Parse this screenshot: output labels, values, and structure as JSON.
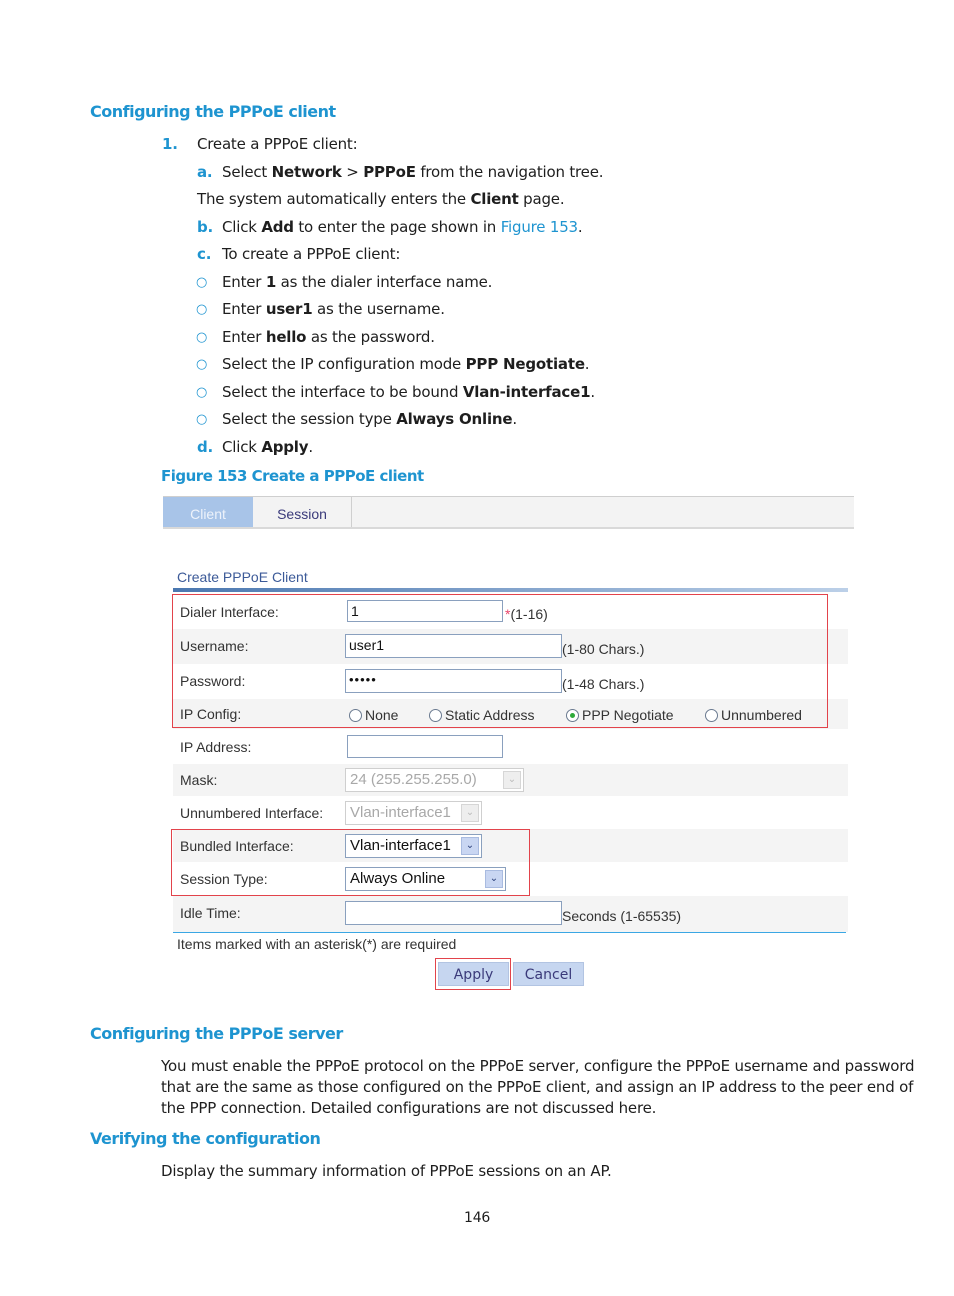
{
  "section1": {
    "heading": "Configuring the PPPoE client",
    "step1": {
      "marker": "1.",
      "text": "Create a PPPoE client:"
    },
    "step_a": {
      "marker": "a.",
      "pre": "Select ",
      "b1": "Network",
      "mid": " > ",
      "b2": "PPPoE",
      "post": " from the navigation tree."
    },
    "step_a_note": {
      "pre": "The system automatically enters the ",
      "b": "Client",
      "post": " page."
    },
    "step_b": {
      "marker": "b.",
      "pre": "Click ",
      "b": "Add",
      "mid": " to enter the page shown in ",
      "link": "Figure 153",
      "post": "."
    },
    "step_c": {
      "marker": "c.",
      "text": "To create a PPPoE client:"
    },
    "bullets": [
      {
        "bullet": "○",
        "pre": "Enter ",
        "b": "1",
        "post": " as the dialer interface name."
      },
      {
        "bullet": "○",
        "pre": "Enter ",
        "b": "user1",
        "post": " as the username."
      },
      {
        "bullet": "○",
        "pre": "Enter ",
        "b": "hello",
        "post": " as the password."
      },
      {
        "bullet": "○",
        "pre": "Select the IP configuration mode ",
        "b": "PPP Negotiate",
        "post": "."
      },
      {
        "bullet": "○",
        "pre": "Select the interface to be bound ",
        "b": "Vlan-interface1",
        "post": "."
      },
      {
        "bullet": "○",
        "pre": "Select the session type ",
        "b": "Always Online",
        "post": "."
      }
    ],
    "step_d": {
      "marker": "d.",
      "pre": "Click ",
      "b": "Apply",
      "post": "."
    },
    "figure_caption": "Figure 153 Create a PPPoE client"
  },
  "figure": {
    "tabs": [
      {
        "label": "Client",
        "active": true
      },
      {
        "label": "Session",
        "active": false
      }
    ],
    "form_title": "Create PPPoE Client",
    "fields": {
      "dialer_interface": {
        "label": "Dialer Interface:",
        "value": "1",
        "required_mark": "*",
        "hint": "(1-16)"
      },
      "username": {
        "label": "Username:",
        "value": "user1",
        "hint": "(1-80 Chars.)"
      },
      "password": {
        "label": "Password:",
        "value": "•••••",
        "hint": "(1-48 Chars.)"
      },
      "ip_config": {
        "label": "IP Config:",
        "options": [
          {
            "label": "None",
            "selected": false
          },
          {
            "label": "Static Address",
            "selected": false
          },
          {
            "label": "PPP Negotiate",
            "selected": true
          },
          {
            "label": "Unnumbered",
            "selected": false
          }
        ]
      },
      "ip_address": {
        "label": "IP Address:",
        "value": ""
      },
      "mask": {
        "label": "Mask:",
        "value": "24 (255.255.255.0)",
        "disabled": true
      },
      "unnumbered_interface": {
        "label": "Unnumbered Interface:",
        "value": "Vlan-interface1",
        "disabled": true
      },
      "bundled_interface": {
        "label": "Bundled Interface:",
        "value": "Vlan-interface1"
      },
      "session_type": {
        "label": "Session Type:",
        "value": "Always Online"
      },
      "idle_time": {
        "label": "Idle Time:",
        "value": "",
        "hint": "Seconds (1-65535)"
      }
    },
    "required_note": "Items marked with an asterisk(*) are required",
    "buttons": {
      "apply": "Apply",
      "cancel": "Cancel"
    },
    "dropdown_arrow": "⌄"
  },
  "section2": {
    "heading": "Configuring the PPPoE server",
    "paragraph_lines": [
      "You must enable the PPPoE protocol on the PPPoE server, configure the PPPoE username and password",
      "that are the same as those configured on the PPPoE client, and assign an IP address to the peer end of",
      "the PPP connection. Detailed configurations are not discussed here."
    ]
  },
  "section3": {
    "heading": "Verifying the configuration",
    "paragraph": "Display the summary information of PPPoE sessions on an AP."
  },
  "page_number": "146"
}
